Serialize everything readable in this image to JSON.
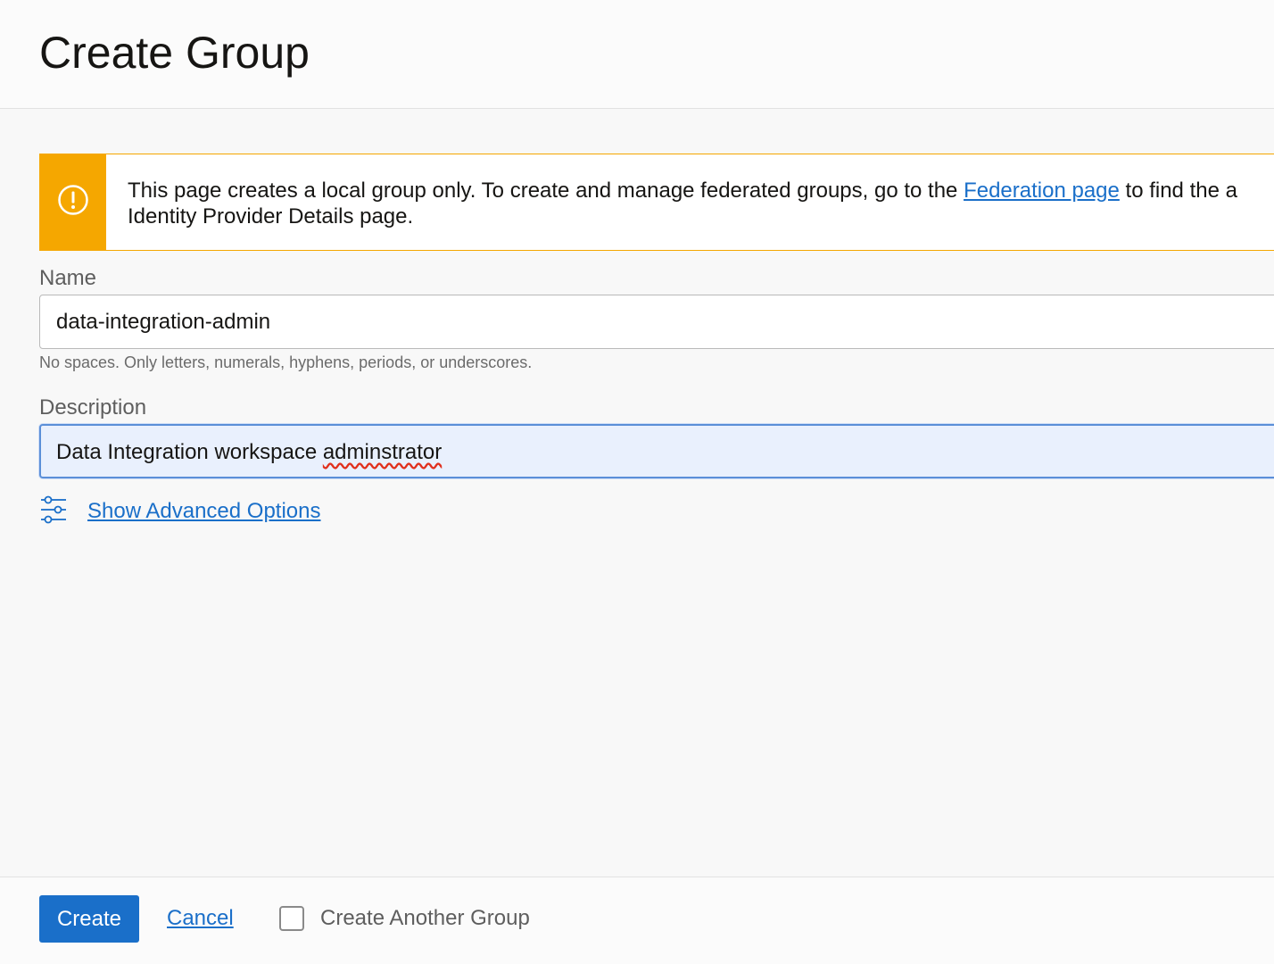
{
  "header": {
    "title": "Create Group"
  },
  "alert": {
    "icon": "warning-circle-icon",
    "text_before_link": "This page creates a local group only. To create and manage federated groups, go to the ",
    "link_label": "Federation page",
    "text_after_link": " to find the a",
    "text_line2": "Identity Provider Details page."
  },
  "form": {
    "name_label": "Name",
    "name_value": "data-integration-admin",
    "name_hint": "No spaces. Only letters, numerals, hyphens, periods, or underscores.",
    "description_label": "Description",
    "description_value_prefix": "Data Integration workspace ",
    "description_value_misspelled": "adminstrator",
    "advanced_icon": "sliders-icon",
    "advanced_link": "Show Advanced Options"
  },
  "footer": {
    "create_label": "Create",
    "cancel_label": "Cancel",
    "create_another_label": "Create Another Group"
  },
  "colors": {
    "accent": "#1a6fc9",
    "warning": "#f5a700"
  }
}
